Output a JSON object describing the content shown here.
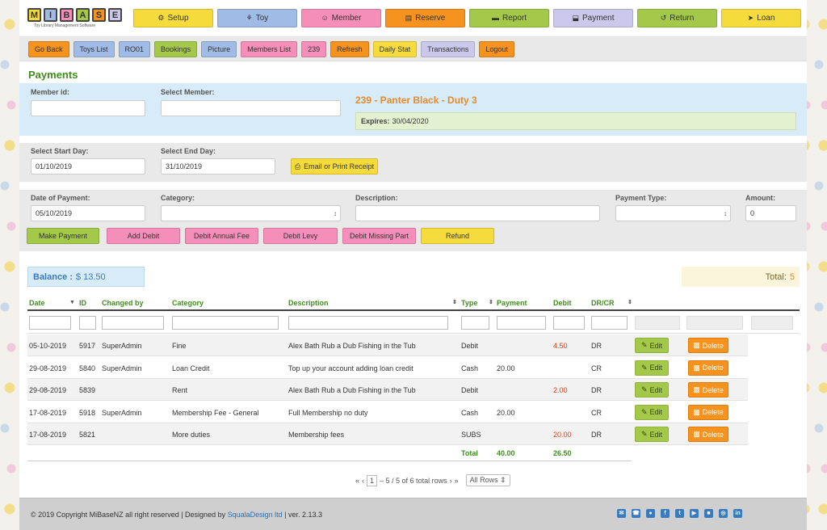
{
  "logo": {
    "letters": [
      "M",
      "I",
      "B",
      "A",
      "S",
      "E"
    ],
    "tagline": "Toy Library Management Software"
  },
  "mainnav": [
    {
      "label": "Setup",
      "icon": "gears-icon",
      "glyph": "⚙",
      "color": "#f5dc3c"
    },
    {
      "label": "Toy",
      "icon": "bike-icon",
      "glyph": "⚘",
      "color": "#9fbbe6"
    },
    {
      "label": "Member",
      "icon": "users-icon",
      "glyph": "☺",
      "color": "#f58fb9"
    },
    {
      "label": "Reserve",
      "icon": "calendar-icon",
      "glyph": "▤",
      "color": "#f6921e"
    },
    {
      "label": "Report",
      "icon": "report-icon",
      "glyph": "▬",
      "color": "#a3c84a"
    },
    {
      "label": "Payment",
      "icon": "payment-icon",
      "glyph": "⬓",
      "color": "#cbc8ec"
    },
    {
      "label": "Return",
      "icon": "return-icon",
      "glyph": "↺",
      "color": "#a3c84a"
    },
    {
      "label": "Loan",
      "icon": "send-icon",
      "glyph": "➤",
      "color": "#f5dc3c"
    }
  ],
  "subnav": [
    {
      "label": "Go Back",
      "color": "#f6921e"
    },
    {
      "label": "Toys List",
      "color": "#9fbbe6"
    },
    {
      "label": "RO01",
      "color": "#9fbbe6"
    },
    {
      "label": "Bookings",
      "color": "#a3c84a"
    },
    {
      "label": "Picture",
      "color": "#9fbbe6"
    },
    {
      "label": "Members List",
      "color": "#f58fb9"
    },
    {
      "label": "239",
      "color": "#f58fb9"
    },
    {
      "label": "Refresh",
      "color": "#f6921e"
    },
    {
      "label": "Daily Stat",
      "color": "#f5dc3c"
    },
    {
      "label": "Transactions",
      "color": "#cbc8ec"
    },
    {
      "label": "Logout",
      "color": "#f6921e"
    }
  ],
  "page_title": "Payments",
  "member": {
    "id_label": "Member id:",
    "id_value": "",
    "select_label": "Select Member:",
    "select_value": "",
    "name": "239 - Panter Black - Duty 3",
    "expires_label": "Expires:",
    "expires_value": "30/04/2020"
  },
  "dates": {
    "start_label": "Select Start Day:",
    "start_value": "01/10/2019",
    "end_label": "Select End Day:",
    "end_value": "31/10/2019",
    "receipt_button": "Email or Print Receipt"
  },
  "payment_form": {
    "date_label": "Date of Payment:",
    "date_value": "05/10/2019",
    "category_label": "Category:",
    "category_value": "",
    "description_label": "Description:",
    "description_value": "",
    "type_label": "Payment Type:",
    "type_value": "",
    "amount_label": "Amount:",
    "amount_value": "0",
    "buttons": [
      {
        "label": "Make Payment",
        "color": "#a3c84a"
      },
      {
        "label": "Add Debit",
        "color": "#f58fb9"
      },
      {
        "label": "Debit Annual Fee",
        "color": "#f58fb9"
      },
      {
        "label": "Debit Levy",
        "color": "#f58fb9"
      },
      {
        "label": "Debit Missing Part",
        "color": "#f58fb9"
      },
      {
        "label": "Refund",
        "color": "#f5dc3c"
      }
    ]
  },
  "balance": {
    "label": "Balance :",
    "value": "$ 13.50"
  },
  "total": {
    "label": "Total:",
    "value": "5"
  },
  "table": {
    "headers": [
      "Date",
      "ID",
      "Changed by",
      "Category",
      "Description",
      "Type",
      "Payment",
      "Debit",
      "DR/CR"
    ],
    "rows": [
      {
        "date": "05-10-2019",
        "id": "5917",
        "changed_by": "SuperAdmin",
        "category": "Fine",
        "description": "Alex Bath Rub a Dub Fishing in the Tub",
        "type": "Debit",
        "payment": "",
        "debit": "4.50",
        "drcr": "DR"
      },
      {
        "date": "29-08-2019",
        "id": "5840",
        "changed_by": "SuperAdmin",
        "category": "Loan Credit",
        "description": "Top up your account adding loan credit",
        "type": "Cash",
        "payment": "20.00",
        "debit": "",
        "drcr": "CR"
      },
      {
        "date": "29-08-2019",
        "id": "5839",
        "changed_by": "",
        "category": "Rent",
        "description": "Alex Bath Rub a Dub Fishing in the Tub",
        "type": "Debit",
        "payment": "",
        "debit": "2.00",
        "drcr": "DR"
      },
      {
        "date": "17-08-2019",
        "id": "5918",
        "changed_by": "SuperAdmin",
        "category": "Membership Fee - General",
        "description": "Full Membership no duty",
        "type": "Cash",
        "payment": "20.00",
        "debit": "",
        "drcr": "CR"
      },
      {
        "date": "17-08-2019",
        "id": "5821",
        "changed_by": "",
        "category": "More duties",
        "description": "Membership fees",
        "type": "SUBS",
        "payment": "",
        "debit": "20.00",
        "drcr": "DR"
      }
    ],
    "edit_label": "Edit",
    "delete_label": "Delete",
    "totals": {
      "label": "Total",
      "payment": "40.00",
      "debit": "26.50"
    }
  },
  "pager": {
    "page": "1",
    "text": "– 5 / 5 of 6 total rows",
    "rows_select": "All Rows"
  },
  "footer": {
    "copyright": "© 2019 Copyright MiBaseNZ all right reserved | Designed by",
    "designer": "SqualaDesign ltd",
    "version": "| ver. 2.13.3",
    "socials": [
      "envelope-icon",
      "phone-icon",
      "globe-icon",
      "facebook-icon",
      "twitter-icon",
      "youtube-icon",
      "book-icon",
      "instagram-icon",
      "linkedin-icon"
    ]
  }
}
